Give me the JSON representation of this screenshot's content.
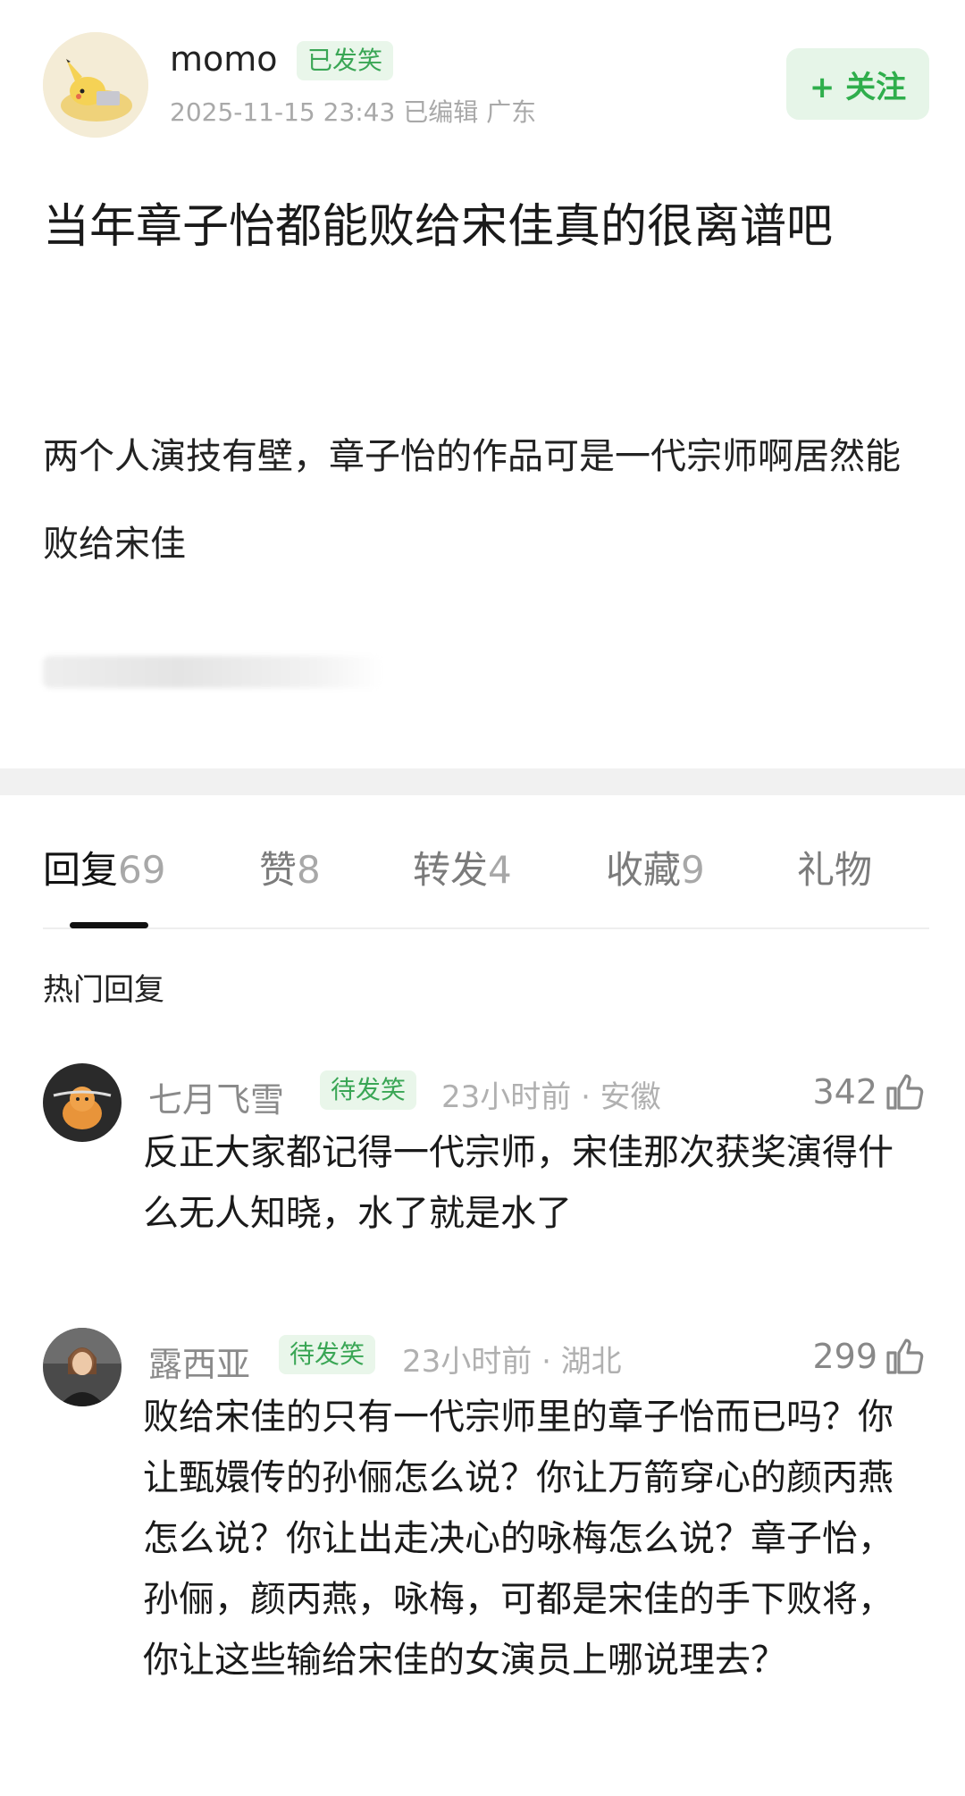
{
  "post": {
    "username": "momo",
    "badge": "已发笑",
    "meta": "2025-11-15 23:43  已编辑  广东",
    "follow_label": "+ 关注",
    "title": "当年章子怡都能败给宋佳真的很离谱吧",
    "body": "两个人演技有壁，章子怡的作品可是一代宗师啊居然能败给宋佳"
  },
  "tabs": [
    {
      "label": "回复",
      "count": "69"
    },
    {
      "label": "赞",
      "count": "8"
    },
    {
      "label": "转发",
      "count": "4"
    },
    {
      "label": "收藏",
      "count": "9"
    },
    {
      "label": "礼物",
      "count": ""
    }
  ],
  "hot_replies_title": "热门回复",
  "comments": [
    {
      "name": "七月飞雪",
      "badge": "待发笑",
      "meta": "23小时前 · 安徽",
      "likes": "342",
      "text": "反正大家都记得一代宗师，宋佳那次获奖演得什么无人知晓，水了就是水了"
    },
    {
      "name": "露西亚",
      "badge": "待发笑",
      "meta": "23小时前 · 湖北",
      "likes": "299",
      "text": "败给宋佳的只有一代宗师里的章子怡而已吗？你让甄嬛传的孙俪怎么说？你让万箭穿心的颜丙燕怎么说？你让出走决心的咏梅怎么说？章子怡，孙俪，颜丙燕，咏梅，可都是宋佳的手下败将，你让这些输给宋佳的女演员上哪说理去？"
    }
  ],
  "colors": {
    "accent_green": "#2fae4c",
    "badge_bg": "#e9f6ea"
  }
}
